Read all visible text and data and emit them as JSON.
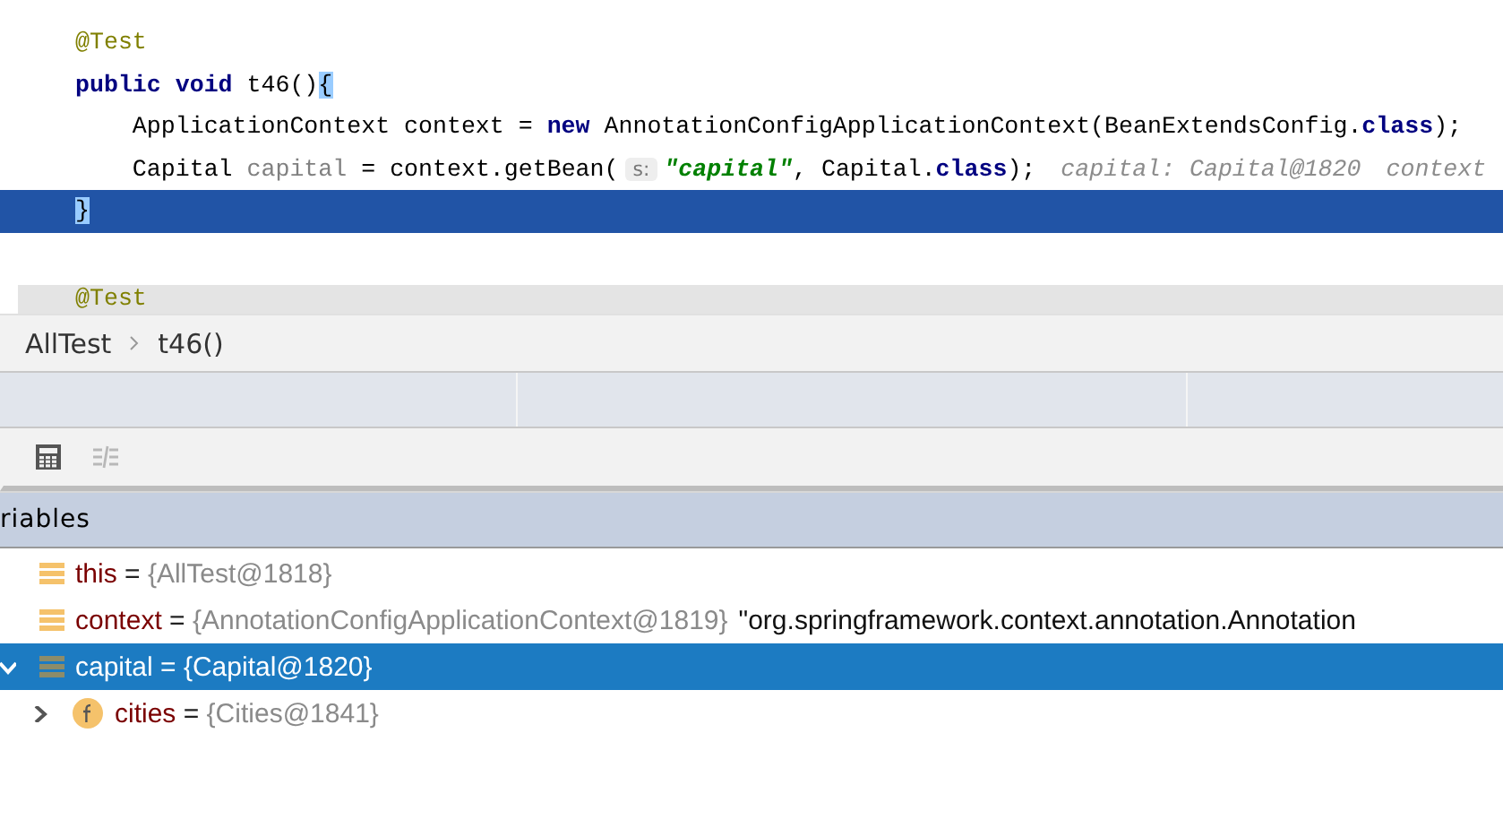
{
  "editor": {
    "lines": [
      {
        "current": false,
        "tokens": [
          {
            "kind": "annotation",
            "text": "@Test"
          }
        ]
      },
      {
        "current": false,
        "tokens": [
          {
            "kind": "keyword",
            "text": "public void"
          },
          {
            "kind": "plain",
            "text": " t46()"
          },
          {
            "kind": "brace_match",
            "text": "{"
          }
        ]
      },
      {
        "current": false,
        "tokens": [
          {
            "kind": "plain",
            "text": "    ApplicationContext context = "
          },
          {
            "kind": "keyword",
            "text": "new"
          },
          {
            "kind": "plain",
            "text": " AnnotationConfigApplicationContext(BeanExtendsConfig."
          },
          {
            "kind": "keyword",
            "text": "class"
          },
          {
            "kind": "plain",
            "text": ");"
          }
        ]
      },
      {
        "current": false,
        "tokens": [
          {
            "kind": "plain",
            "text": "    Capital "
          },
          {
            "kind": "unused",
            "text": "capital"
          },
          {
            "kind": "plain",
            "text": " = context.getBean("
          },
          {
            "kind": "param_hint",
            "text": "s:"
          },
          {
            "kind": "string",
            "text": "\"capital\""
          },
          {
            "kind": "plain",
            "text": ", Capital."
          },
          {
            "kind": "keyword",
            "text": "class"
          },
          {
            "kind": "plain",
            "text": ");"
          },
          {
            "kind": "inline_hint",
            "text": "capital: Capital@1820"
          },
          {
            "kind": "inline_hint",
            "text": "context"
          }
        ]
      },
      {
        "current": true,
        "tokens": [
          {
            "kind": "brace_match",
            "text": "}"
          }
        ]
      },
      {
        "current": false
      }
    ],
    "sticky_line": {
      "tokens": [
        {
          "kind": "annotation",
          "text": "@Test"
        }
      ]
    }
  },
  "breadcrumbs": [
    "AllTest",
    "t46()"
  ],
  "toolbar": [
    {
      "kind": "calculator",
      "disabled": false
    },
    {
      "kind": "compare",
      "disabled": true
    }
  ],
  "variables": {
    "title": "riables",
    "items": [
      {
        "kind": "variable",
        "name": "this",
        "operator": "=",
        "value": "{AllTest@1818}",
        "selected": false
      },
      {
        "kind": "variable",
        "name": "context",
        "operator": "=",
        "value": "{AnnotationConfigApplicationContext@1819}",
        "string": "\"org.springframework.context.annotation.Annotation",
        "selected": false
      },
      {
        "kind": "variable",
        "name": "capital",
        "operator": "=",
        "value": "{Capital@1820}",
        "selected": true,
        "expanded": true,
        "children": [
          {
            "kind": "field",
            "name": "cities",
            "operator": "=",
            "value": "{Cities@1841}",
            "selected": false,
            "expanded": false
          }
        ]
      }
    ]
  }
}
